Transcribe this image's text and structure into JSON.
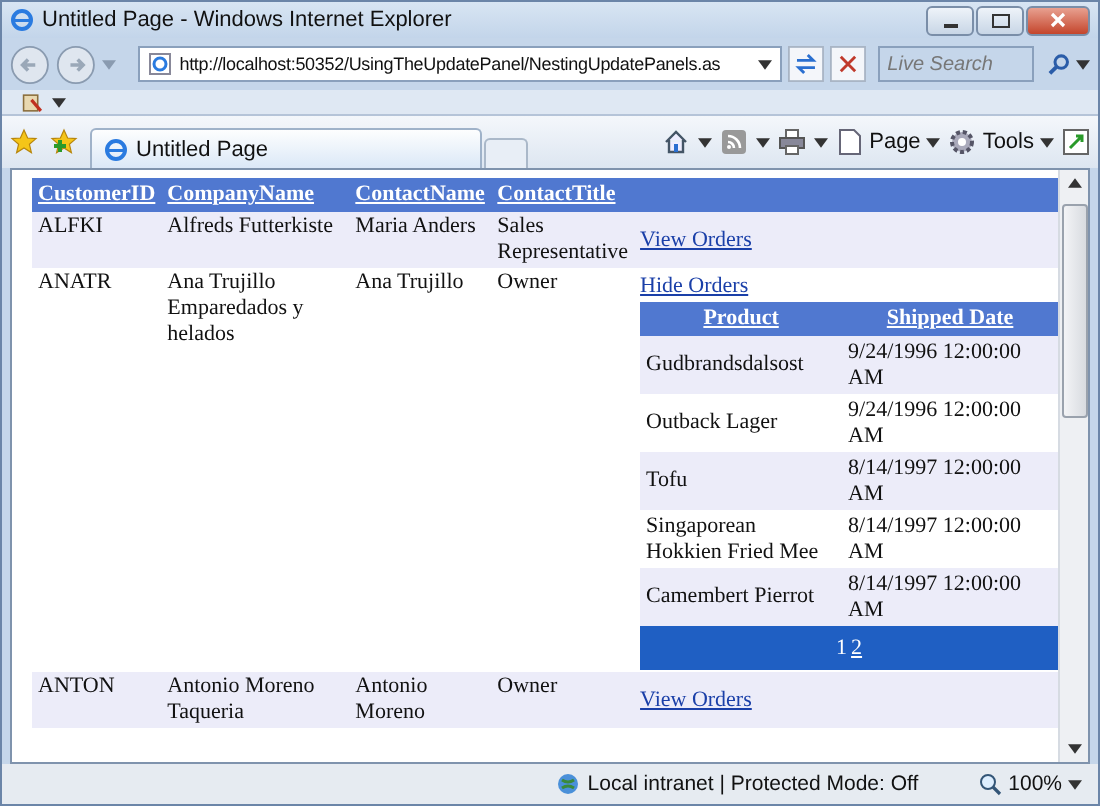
{
  "window": {
    "title": "Untitled Page - Windows Internet Explorer"
  },
  "address_bar": {
    "url": "http://localhost:50352/UsingTheUpdatePanel/NestingUpdatePanels.as"
  },
  "search": {
    "placeholder": "Live Search"
  },
  "tab": {
    "title": "Untitled Page"
  },
  "command_bar": [
    "Page",
    "Tools"
  ],
  "customers": {
    "columns": [
      "CustomerID",
      "CompanyName",
      "ContactName",
      "ContactTitle"
    ],
    "rows": [
      {
        "id": "ALFKI",
        "company": "Alfreds Futterkiste",
        "contact": "Maria Anders",
        "title": "Sales Representative",
        "link": "View Orders"
      },
      {
        "id": "ANATR",
        "company": "Ana Trujillo Emparedados y helados",
        "contact": "Ana Trujillo",
        "title": "Owner",
        "link": "Hide Orders",
        "orders": {
          "columns": [
            "Product",
            "Shipped Date"
          ],
          "rows": [
            {
              "product": "Gudbrandsdalsost",
              "date": "9/24/1996 12:00:00 AM"
            },
            {
              "product": "Outback Lager",
              "date": "9/24/1996 12:00:00 AM"
            },
            {
              "product": "Tofu",
              "date": "8/14/1997 12:00:00 AM"
            },
            {
              "product": "Singaporean Hokkien Fried Mee",
              "date": "8/14/1997 12:00:00 AM"
            },
            {
              "product": "Camembert Pierrot",
              "date": "8/14/1997 12:00:00 AM"
            }
          ],
          "pages": [
            {
              "label": "1",
              "selected": true
            },
            {
              "label": "2",
              "selected": false
            }
          ]
        }
      },
      {
        "id": "ANTON",
        "company": "Antonio Moreno Taqueria",
        "contact": "Antonio Moreno",
        "title": "Owner",
        "link": "View Orders"
      }
    ]
  },
  "status_bar": {
    "zone": "Local intranet | Protected Mode: Off",
    "zoom": "100%"
  }
}
